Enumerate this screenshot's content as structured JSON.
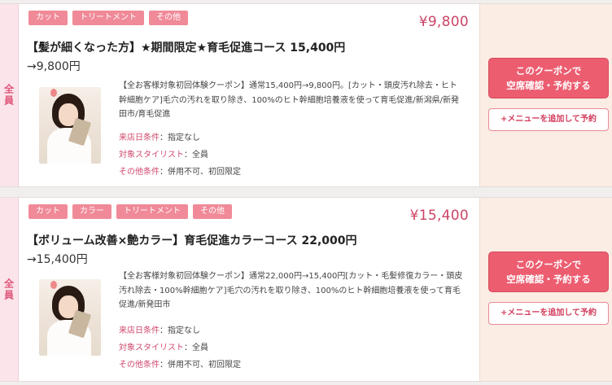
{
  "coupons": [
    {
      "target": "全員",
      "tags": [
        "カット",
        "トリートメント",
        "その他"
      ],
      "price": "¥9,800",
      "title_line1": "【髪が細くなった方】★期間限定★育毛促進コース 15,400円",
      "title_line2": "→9,800円",
      "desc": "【全お客様対象初回体験クーポン】通常15,400円→9,800円。[カット・頭皮汚れ除去・ヒト幹細胞ケア]毛穴の汚れを取り除き、100%のヒト幹細胞培養液を使って育毛促進/新潟県/新発田市/育毛促進",
      "conditions": [
        {
          "label": "来店日条件",
          "value": "：指定なし"
        },
        {
          "label": "対象スタイリスト",
          "value": "：全員"
        },
        {
          "label": "その他条件",
          "value": "：併用不可、初回限定"
        }
      ],
      "reserve_line1": "このクーポンで",
      "reserve_line2": "空席確認・予約する",
      "add_menu": "+メニューを追加して予約"
    },
    {
      "target": "全員",
      "tags": [
        "カット",
        "カラー",
        "トリートメント",
        "その他"
      ],
      "price": "¥15,400",
      "title_line1": "【ボリューム改善×艶カラー】育毛促進カラーコース 22,000円",
      "title_line2": "→15,400円",
      "desc": "【全お客様対象初回体験クーポン】通常22,000円→15,400円[カット・毛髪修復カラー・頭皮汚れ除去・100%幹細胞ケア]毛穴の汚れを取り除き、100%のヒト幹細胞培養液を使って育毛促進/新発田市",
      "conditions": [
        {
          "label": "来店日条件",
          "value": "：指定なし"
        },
        {
          "label": "対象スタイリスト",
          "value": "：全員"
        },
        {
          "label": "その他条件",
          "value": "：併用不可、初回限定"
        }
      ],
      "reserve_line1": "このクーポンで",
      "reserve_line2": "空席確認・予約する",
      "add_menu": "+メニューを追加して予約"
    }
  ]
}
